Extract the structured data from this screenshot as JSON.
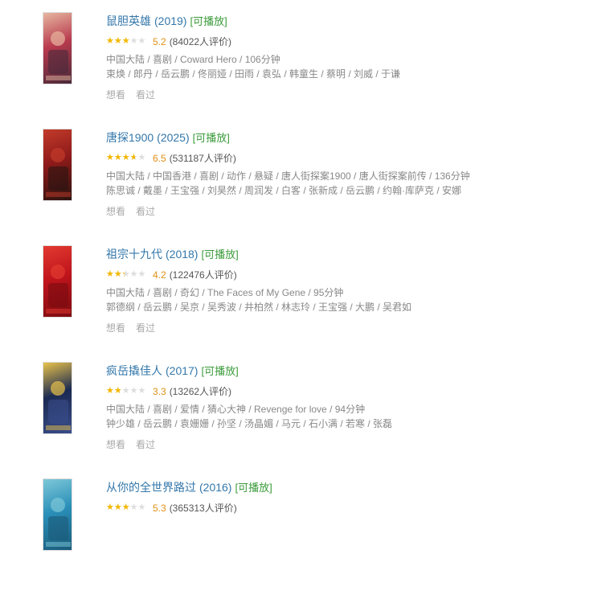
{
  "items": [
    {
      "title": "鼠胆英雄",
      "year": "(2019)",
      "playable": "[可播放]",
      "rating": 2.6,
      "score": "5.2",
      "votes": "(84022人评价)",
      "meta": "中国大陆 / 喜剧 / Coward Hero / 106分钟",
      "cast": "束焕 / 郎丹 / 岳云鹏 / 佟丽娅 / 田雨 / 袁弘 / 韩童生 / 蔡明 / 刘威 / 于谦",
      "want": "想看",
      "seen": "看过",
      "poster_colors": [
        "#b83a4e",
        "#e7b7a0",
        "#4a2a3a"
      ]
    },
    {
      "title": "唐探1900",
      "year": "(2025)",
      "playable": "[可播放]",
      "rating": 3.25,
      "score": "6.5",
      "votes": "(531187人评价)",
      "meta": "中国大陆 / 中国香港 / 喜剧 / 动作 / 悬疑 / 唐人街探案1900 / 唐人街探案前传 / 136分钟",
      "cast": "陈思诚 / 戴墨 / 王宝强 / 刘昊然 / 周润发 / 白客 / 张新成 / 岳云鹏 / 约翰·库萨克 / 安娜",
      "want": "想看",
      "seen": "看过",
      "poster_colors": [
        "#8e1a1a",
        "#c23b2a",
        "#2a1410"
      ]
    },
    {
      "title": "祖宗十九代",
      "year": "(2018)",
      "playable": "[可播放]",
      "rating": 2.1,
      "score": "4.2",
      "votes": "(122476人评价)",
      "meta": "中国大陆 / 喜剧 / 奇幻 / The Faces of My Gene / 95分钟",
      "cast": "郭德纲 / 岳云鹏 / 吴京 / 吴秀波 / 井柏然 / 林志玲 / 王宝强 / 大鹏 / 吴君如",
      "want": "想看",
      "seen": "看过",
      "poster_colors": [
        "#c0141c",
        "#e23a30",
        "#7a0c10"
      ]
    },
    {
      "title": "疯岳撬佳人",
      "year": "(2017)",
      "playable": "[可播放]",
      "rating": 1.65,
      "score": "3.3",
      "votes": "(13262人评价)",
      "meta": "中国大陆 / 喜剧 / 爱情 / 猜心大神 / Revenge for love / 94分钟",
      "cast": "钟少雄 / 岳云鹏 / 袁姗姗 / 孙坚 / 汤晶媚 / 马元 / 石小满 / 若寒 / 张磊",
      "want": "想看",
      "seen": "看过",
      "poster_colors": [
        "#1b2a52",
        "#e8c24a",
        "#3a4d8a"
      ]
    },
    {
      "title": "从你的全世界路过",
      "year": "(2016)",
      "playable": "[可播放]",
      "rating": 2.65,
      "score": "5.3",
      "votes": "(365313人评价)",
      "meta": "",
      "cast": "",
      "want": "",
      "seen": "",
      "poster_colors": [
        "#2a8fb8",
        "#7ec8d8",
        "#1a5a7a"
      ]
    }
  ]
}
